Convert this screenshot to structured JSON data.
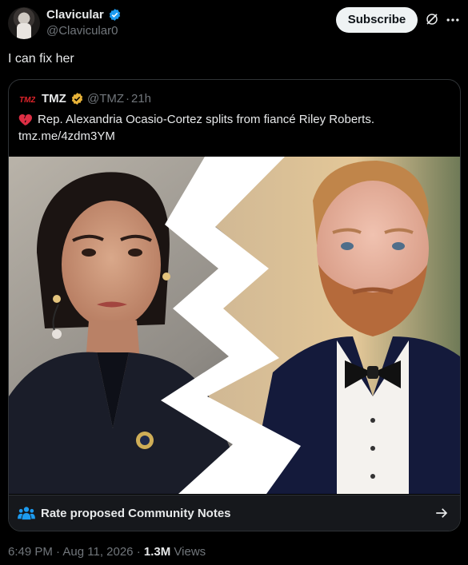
{
  "author": {
    "name": "Clavicular",
    "handle": "@Clavicular0"
  },
  "actions": {
    "subscribe_label": "Subscribe"
  },
  "tweet": {
    "text": "I can fix her"
  },
  "quote": {
    "logo_text": "TMZ",
    "name": "TMZ",
    "handle": "@TMZ",
    "separator": "·",
    "time": "21h",
    "text": "Rep. Alexandria Ocasio-Cortez splits from fiancé Riley Roberts.",
    "link": "tmz.me/4zdm3YM"
  },
  "community_notes": {
    "label": "Rate proposed Community Notes"
  },
  "footer": {
    "time": "6:49 PM",
    "separator": "·",
    "date": "Aug 11, 2026",
    "views_count": "1.3M",
    "views_label": "Views"
  },
  "colors": {
    "background": "#000000",
    "accent_blue": "#1d9bf0",
    "verified_gold": "#e8b339",
    "muted_text": "#71767b",
    "tmz_red": "#e0242b"
  },
  "icons": [
    "verified-badge-icon",
    "grok-icon",
    "more-icon",
    "broken-heart-icon",
    "community-notes-icon",
    "arrow-right-icon"
  ]
}
